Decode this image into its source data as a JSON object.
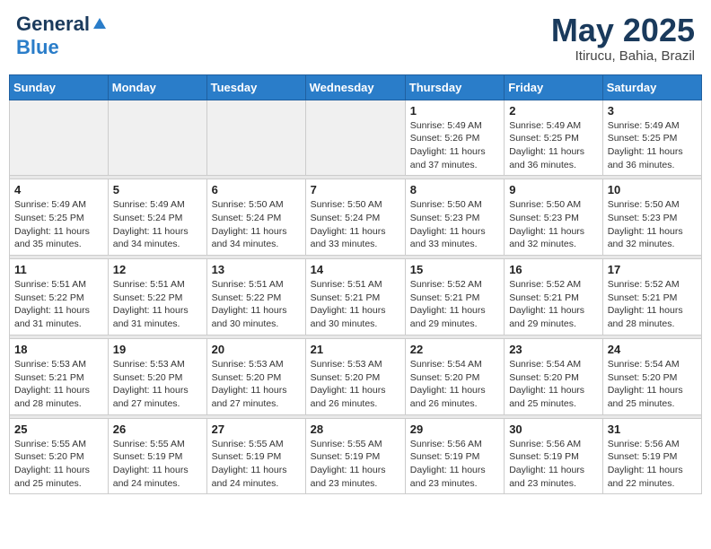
{
  "header": {
    "logo_general": "General",
    "logo_blue": "Blue",
    "title": "May 2025",
    "location": "Itirucu, Bahia, Brazil"
  },
  "days_of_week": [
    "Sunday",
    "Monday",
    "Tuesday",
    "Wednesday",
    "Thursday",
    "Friday",
    "Saturday"
  ],
  "weeks": [
    [
      {
        "day": "",
        "empty": true
      },
      {
        "day": "",
        "empty": true
      },
      {
        "day": "",
        "empty": true
      },
      {
        "day": "",
        "empty": true
      },
      {
        "day": "1",
        "sunrise": "5:49 AM",
        "sunset": "5:26 PM",
        "daylight": "11 hours and 37 minutes."
      },
      {
        "day": "2",
        "sunrise": "5:49 AM",
        "sunset": "5:25 PM",
        "daylight": "11 hours and 36 minutes."
      },
      {
        "day": "3",
        "sunrise": "5:49 AM",
        "sunset": "5:25 PM",
        "daylight": "11 hours and 36 minutes."
      }
    ],
    [
      {
        "day": "4",
        "sunrise": "5:49 AM",
        "sunset": "5:25 PM",
        "daylight": "11 hours and 35 minutes."
      },
      {
        "day": "5",
        "sunrise": "5:49 AM",
        "sunset": "5:24 PM",
        "daylight": "11 hours and 34 minutes."
      },
      {
        "day": "6",
        "sunrise": "5:50 AM",
        "sunset": "5:24 PM",
        "daylight": "11 hours and 34 minutes."
      },
      {
        "day": "7",
        "sunrise": "5:50 AM",
        "sunset": "5:24 PM",
        "daylight": "11 hours and 33 minutes."
      },
      {
        "day": "8",
        "sunrise": "5:50 AM",
        "sunset": "5:23 PM",
        "daylight": "11 hours and 33 minutes."
      },
      {
        "day": "9",
        "sunrise": "5:50 AM",
        "sunset": "5:23 PM",
        "daylight": "11 hours and 32 minutes."
      },
      {
        "day": "10",
        "sunrise": "5:50 AM",
        "sunset": "5:23 PM",
        "daylight": "11 hours and 32 minutes."
      }
    ],
    [
      {
        "day": "11",
        "sunrise": "5:51 AM",
        "sunset": "5:22 PM",
        "daylight": "11 hours and 31 minutes."
      },
      {
        "day": "12",
        "sunrise": "5:51 AM",
        "sunset": "5:22 PM",
        "daylight": "11 hours and 31 minutes."
      },
      {
        "day": "13",
        "sunrise": "5:51 AM",
        "sunset": "5:22 PM",
        "daylight": "11 hours and 30 minutes."
      },
      {
        "day": "14",
        "sunrise": "5:51 AM",
        "sunset": "5:21 PM",
        "daylight": "11 hours and 30 minutes."
      },
      {
        "day": "15",
        "sunrise": "5:52 AM",
        "sunset": "5:21 PM",
        "daylight": "11 hours and 29 minutes."
      },
      {
        "day": "16",
        "sunrise": "5:52 AM",
        "sunset": "5:21 PM",
        "daylight": "11 hours and 29 minutes."
      },
      {
        "day": "17",
        "sunrise": "5:52 AM",
        "sunset": "5:21 PM",
        "daylight": "11 hours and 28 minutes."
      }
    ],
    [
      {
        "day": "18",
        "sunrise": "5:53 AM",
        "sunset": "5:21 PM",
        "daylight": "11 hours and 28 minutes."
      },
      {
        "day": "19",
        "sunrise": "5:53 AM",
        "sunset": "5:20 PM",
        "daylight": "11 hours and 27 minutes."
      },
      {
        "day": "20",
        "sunrise": "5:53 AM",
        "sunset": "5:20 PM",
        "daylight": "11 hours and 27 minutes."
      },
      {
        "day": "21",
        "sunrise": "5:53 AM",
        "sunset": "5:20 PM",
        "daylight": "11 hours and 26 minutes."
      },
      {
        "day": "22",
        "sunrise": "5:54 AM",
        "sunset": "5:20 PM",
        "daylight": "11 hours and 26 minutes."
      },
      {
        "day": "23",
        "sunrise": "5:54 AM",
        "sunset": "5:20 PM",
        "daylight": "11 hours and 25 minutes."
      },
      {
        "day": "24",
        "sunrise": "5:54 AM",
        "sunset": "5:20 PM",
        "daylight": "11 hours and 25 minutes."
      }
    ],
    [
      {
        "day": "25",
        "sunrise": "5:55 AM",
        "sunset": "5:20 PM",
        "daylight": "11 hours and 25 minutes."
      },
      {
        "day": "26",
        "sunrise": "5:55 AM",
        "sunset": "5:19 PM",
        "daylight": "11 hours and 24 minutes."
      },
      {
        "day": "27",
        "sunrise": "5:55 AM",
        "sunset": "5:19 PM",
        "daylight": "11 hours and 24 minutes."
      },
      {
        "day": "28",
        "sunrise": "5:55 AM",
        "sunset": "5:19 PM",
        "daylight": "11 hours and 23 minutes."
      },
      {
        "day": "29",
        "sunrise": "5:56 AM",
        "sunset": "5:19 PM",
        "daylight": "11 hours and 23 minutes."
      },
      {
        "day": "30",
        "sunrise": "5:56 AM",
        "sunset": "5:19 PM",
        "daylight": "11 hours and 23 minutes."
      },
      {
        "day": "31",
        "sunrise": "5:56 AM",
        "sunset": "5:19 PM",
        "daylight": "11 hours and 22 minutes."
      }
    ]
  ]
}
